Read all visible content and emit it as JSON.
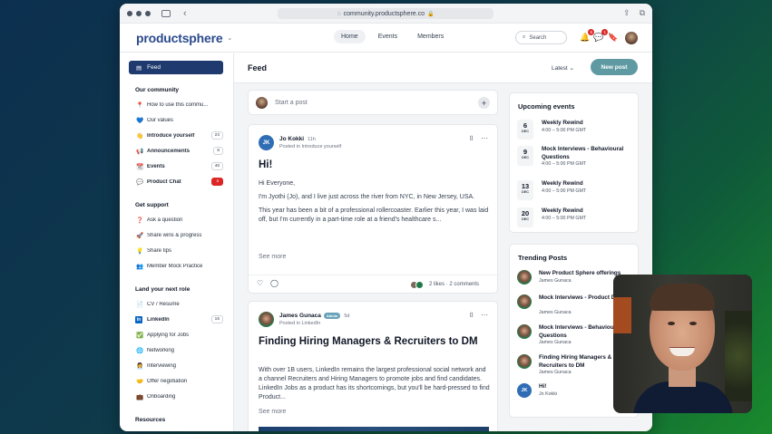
{
  "browser": {
    "url": "community.productsphere.co"
  },
  "app": {
    "logo": "productsphere",
    "nav": [
      "Home",
      "Events",
      "Members"
    ],
    "search_label": "Search",
    "notifications_count": "5",
    "messages_count": "1"
  },
  "sidebar": {
    "feed_label": "Feed",
    "sections": [
      {
        "title": "Our community",
        "items": [
          {
            "icon": "📍",
            "label": "How to use this commu...",
            "bold": false,
            "count": ""
          },
          {
            "icon": "💙",
            "label": "Our values",
            "bold": false,
            "count": ""
          },
          {
            "icon": "👋",
            "label": "Introduce yourself",
            "bold": true,
            "count": "23"
          },
          {
            "icon": "📢",
            "label": "Announcements",
            "bold": true,
            "count": "8"
          },
          {
            "icon": "📆",
            "label": "Events",
            "bold": true,
            "count": "46"
          },
          {
            "icon": "💬",
            "label": "Product Chat",
            "bold": true,
            "count": "4",
            "red": true
          }
        ]
      },
      {
        "title": "Get support",
        "items": [
          {
            "icon": "❓",
            "label": "Ask a question",
            "bold": false,
            "count": ""
          },
          {
            "icon": "🚀",
            "label": "Share wins & progress",
            "bold": false,
            "count": ""
          },
          {
            "icon": "💡",
            "label": "Share tips",
            "bold": false,
            "count": ""
          },
          {
            "icon": "👥",
            "label": "Member Mock Practice",
            "bold": false,
            "count": ""
          }
        ]
      },
      {
        "title": "Land your next role",
        "items": [
          {
            "icon": "📄",
            "label": "CV / Resume",
            "bold": false,
            "count": ""
          },
          {
            "icon": "in",
            "label": "LinkedIn",
            "bold": true,
            "count": "15"
          },
          {
            "icon": "✅",
            "label": "Applying for Jobs",
            "bold": false,
            "count": ""
          },
          {
            "icon": "🌐",
            "label": "Networking",
            "bold": false,
            "count": ""
          },
          {
            "icon": "👩‍💼",
            "label": "Interviewing",
            "bold": false,
            "count": ""
          },
          {
            "icon": "🤝",
            "label": "Offer negotiation",
            "bold": false,
            "count": ""
          },
          {
            "icon": "💼",
            "label": "Onboarding",
            "bold": false,
            "count": ""
          }
        ]
      },
      {
        "title": "Resources",
        "items": []
      }
    ]
  },
  "main": {
    "title": "Feed",
    "sort_label": "Latest",
    "new_post_label": "New post",
    "start_post_placeholder": "Start a post"
  },
  "posts": [
    {
      "author": "Jo Kokki",
      "initials": "JK",
      "time": "11h",
      "posted_in": "Posted in Introduce yourself",
      "title": "Hi!",
      "paragraphs": [
        "Hi Everyone,",
        "I'm Jyothi (Jo), and I live just across the river from NYC, in New Jersey, USA.",
        "This year has been a bit of a professional rollercoaster. Earlier this year, I was laid off, but I'm currently in a part-time role at a friend's healthcare s..."
      ],
      "see_more": "See more",
      "likes": "2 likes",
      "comments": "2 comments"
    },
    {
      "author": "James Gunaca",
      "badge": "Admin",
      "time": "5d",
      "posted_in": "Posted in LinkedIn",
      "title": "Finding Hiring Managers & Recruiters to DM",
      "paragraphs": [
        "With over 1B users, LinkedIn remains the largest professional social network and a channel Recruiters and Hiring Managers to promote jobs and find candidates. LinkedIn Jobs as a product has its shortcomings, but you'll be hard-pressed to find Product..."
      ],
      "see_more": "See more"
    }
  ],
  "events": {
    "title": "Upcoming events",
    "items": [
      {
        "day": "6",
        "month": "DEC",
        "name": "Weekly Rewind",
        "time": "4:00 – 5:00 PM GMT"
      },
      {
        "day": "9",
        "month": "DEC",
        "name": "Mock Interviews - Behavioural Questions",
        "time": "4:00 – 5:00 PM GMT"
      },
      {
        "day": "13",
        "month": "DEC",
        "name": "Weekly Rewind",
        "time": "4:00 – 5:00 PM GMT"
      },
      {
        "day": "20",
        "month": "DEC",
        "name": "Weekly Rewind",
        "time": "4:00 – 5:00 PM GMT"
      }
    ]
  },
  "trending": {
    "title": "Trending Posts",
    "items": [
      {
        "title": "New Product Sphere offerings",
        "author": "James Gunaca"
      },
      {
        "title": "Mock Interviews - Product Design",
        "author": "James Gunaca"
      },
      {
        "title": "Mock Interviews - Behavioural Questions",
        "author": "James Gunaca"
      },
      {
        "title": "Finding Hiring Managers & Recruiters to DM",
        "author": "James Gunaca"
      },
      {
        "title": "Hi!",
        "author": "Jo Kokki",
        "initials": "JK"
      }
    ]
  },
  "colors": {
    "brand": "#2b4a8c",
    "feed_active": "#1e3a6e",
    "new_post": "#5f9aa2",
    "badge_red": "#dc2626"
  }
}
